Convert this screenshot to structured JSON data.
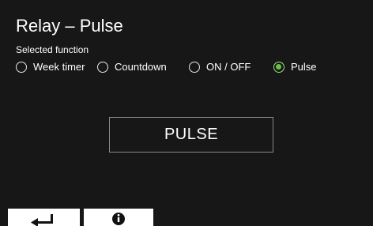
{
  "header": {
    "title": "Relay – Pulse",
    "subtitle": "Selected function"
  },
  "functions": {
    "options": [
      {
        "label": "Week timer",
        "selected": false
      },
      {
        "label": "Countdown",
        "selected": false
      },
      {
        "label": "ON / OFF",
        "selected": false
      },
      {
        "label": "Pulse",
        "selected": true
      }
    ]
  },
  "main": {
    "action_label": "PULSE"
  },
  "footer": {
    "buttons": [
      {
        "icon": "back-arrow-icon"
      },
      {
        "icon": "info-icon"
      }
    ]
  },
  "colors": {
    "background": "#171717",
    "text": "#ffffff",
    "accent_selected": "#6cc14a",
    "button_border": "#8a8a8a",
    "footer_button": "#ffffff"
  }
}
